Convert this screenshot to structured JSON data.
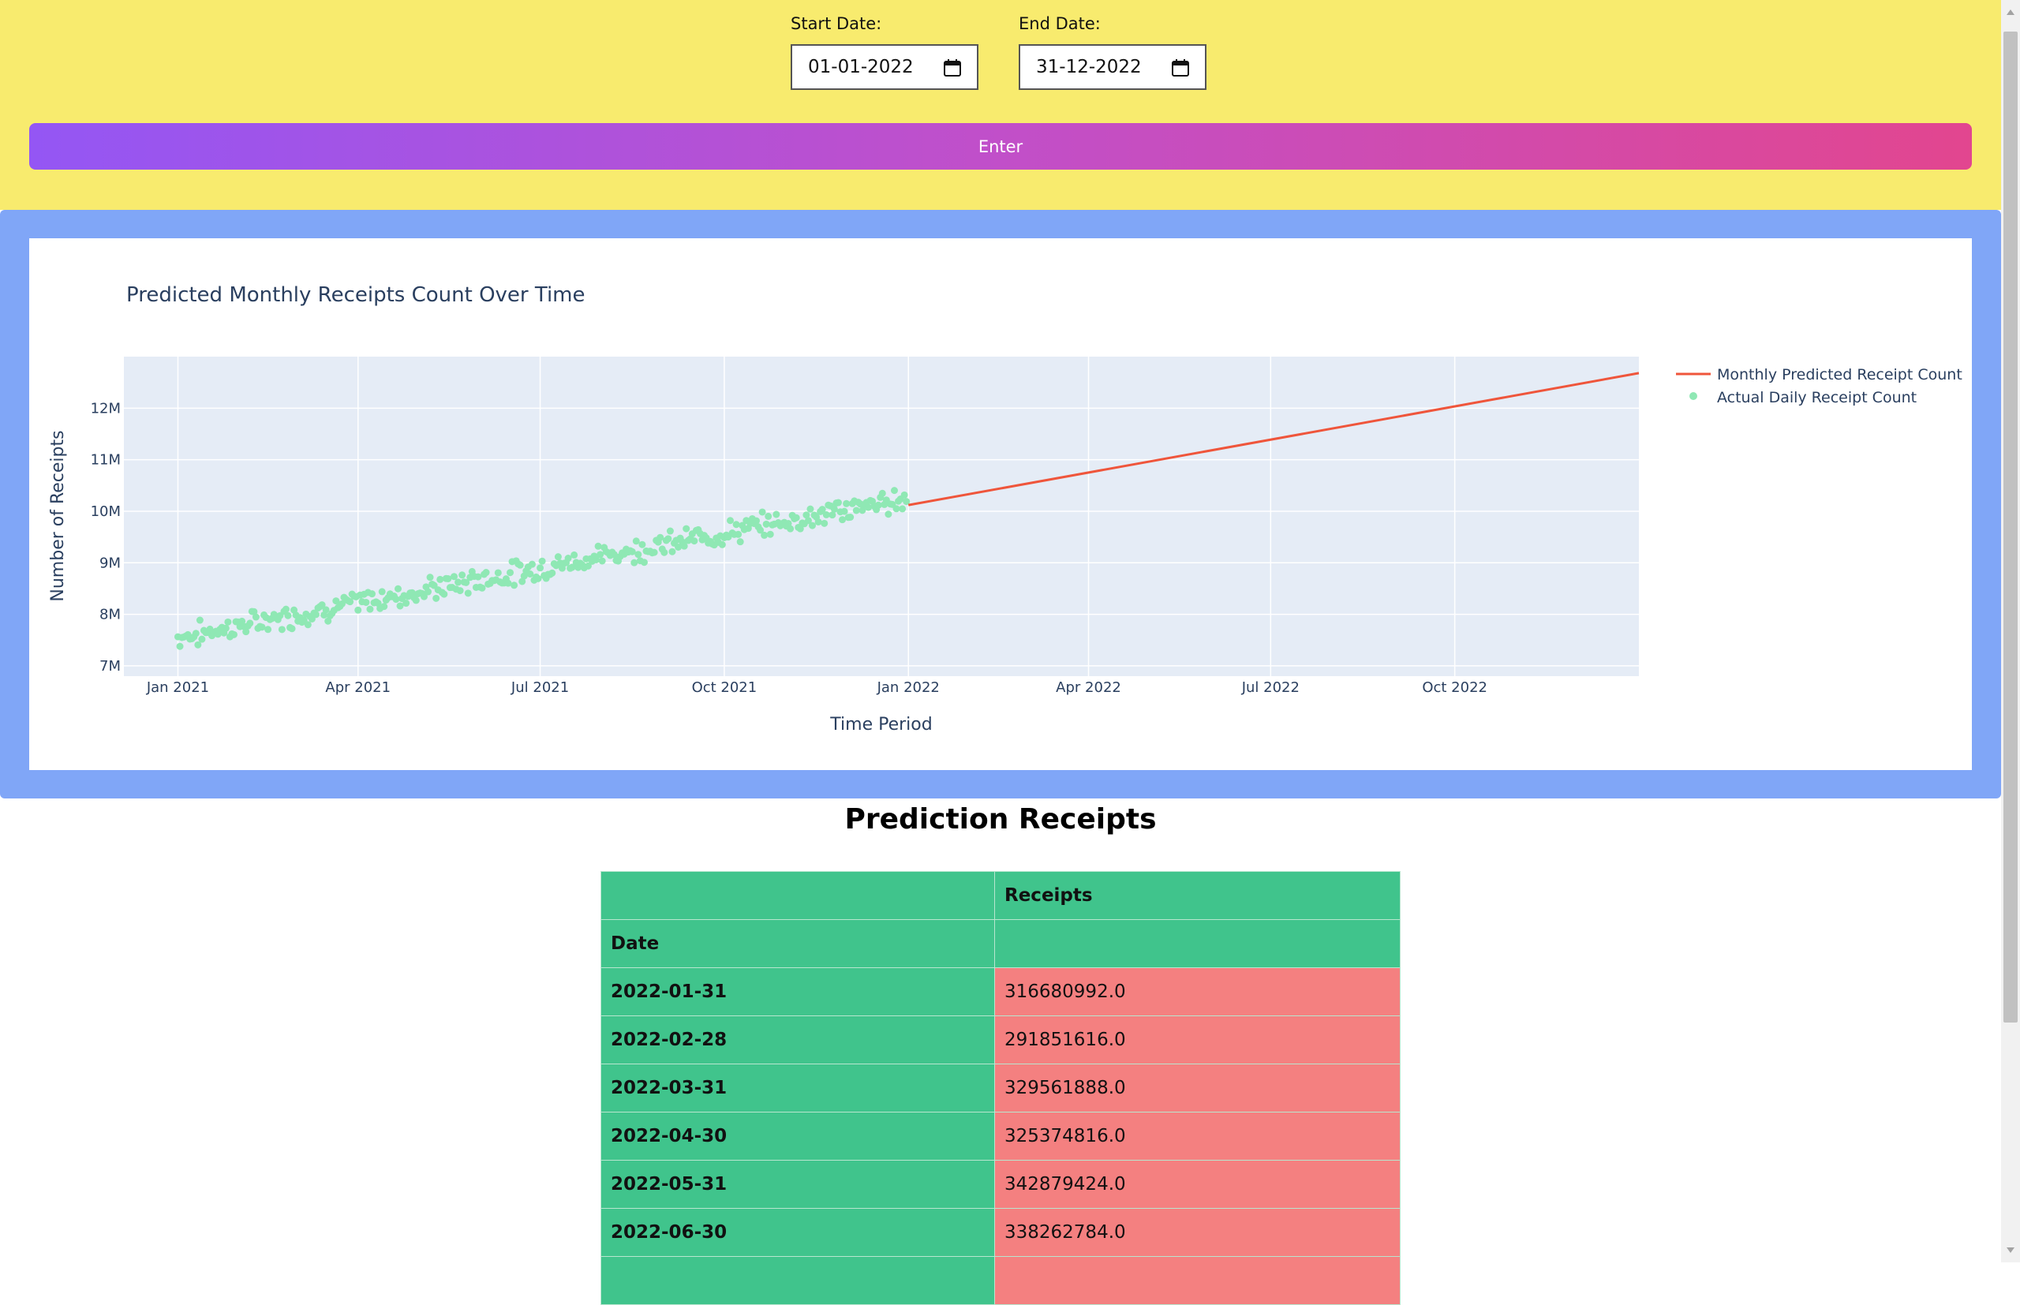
{
  "form": {
    "start_label": "Start Date:",
    "start_value": "01-01-2022",
    "end_label": "End Date:",
    "end_value": "31-12-2022",
    "enter_label": "Enter",
    "calendar_icon": "calendar-icon"
  },
  "chart_data": {
    "type": "line",
    "title": "Predicted Monthly Receipts Count Over Time",
    "xlabel": "Time Period",
    "ylabel": "Number of Receipts",
    "x_ticks": [
      "Jan 2021",
      "Apr 2021",
      "Jul 2021",
      "Oct 2021",
      "Jan 2022",
      "Apr 2022",
      "Jul 2022",
      "Oct 2022"
    ],
    "y_ticks": [
      "7M",
      "8M",
      "9M",
      "10M",
      "11M",
      "12M"
    ],
    "ylim": [
      6.8,
      13.0
    ],
    "xlim": [
      "2020-12-05",
      "2023-01-01"
    ],
    "grid": true,
    "legend_position": "top-right",
    "series": [
      {
        "name": "Monthly Predicted Receipt Count",
        "kind": "line",
        "color": "#ef553b",
        "points": [
          {
            "x": "2022-01-01",
            "y": 10.12
          },
          {
            "x": "2023-01-01",
            "y": 12.68
          }
        ]
      },
      {
        "name": "Actual Daily Receipt Count",
        "kind": "scatter",
        "color": "#8fe8b4",
        "date_range": [
          "2021-01-01",
          "2021-12-31"
        ],
        "trend": [
          7.55,
          10.25
        ],
        "noise": 0.28
      }
    ]
  },
  "table": {
    "title": "Prediction Receipts",
    "col_header": "Receipts",
    "index_header": "Date",
    "rows": [
      {
        "date": "2022-01-31",
        "value": "316680992.0"
      },
      {
        "date": "2022-02-28",
        "value": "291851616.0"
      },
      {
        "date": "2022-03-31",
        "value": "329561888.0"
      },
      {
        "date": "2022-04-30",
        "value": "325374816.0"
      },
      {
        "date": "2022-05-31",
        "value": "342879424.0"
      },
      {
        "date": "2022-06-30",
        "value": "338262784.0"
      },
      {
        "date": "",
        "value": ""
      }
    ]
  },
  "colors": {
    "header_bg": "#f8eb6e",
    "panel_bg": "#80a6f7",
    "table_green": "#40c48c",
    "table_red": "#f48080",
    "plot_bg": "#e5ecf6"
  }
}
